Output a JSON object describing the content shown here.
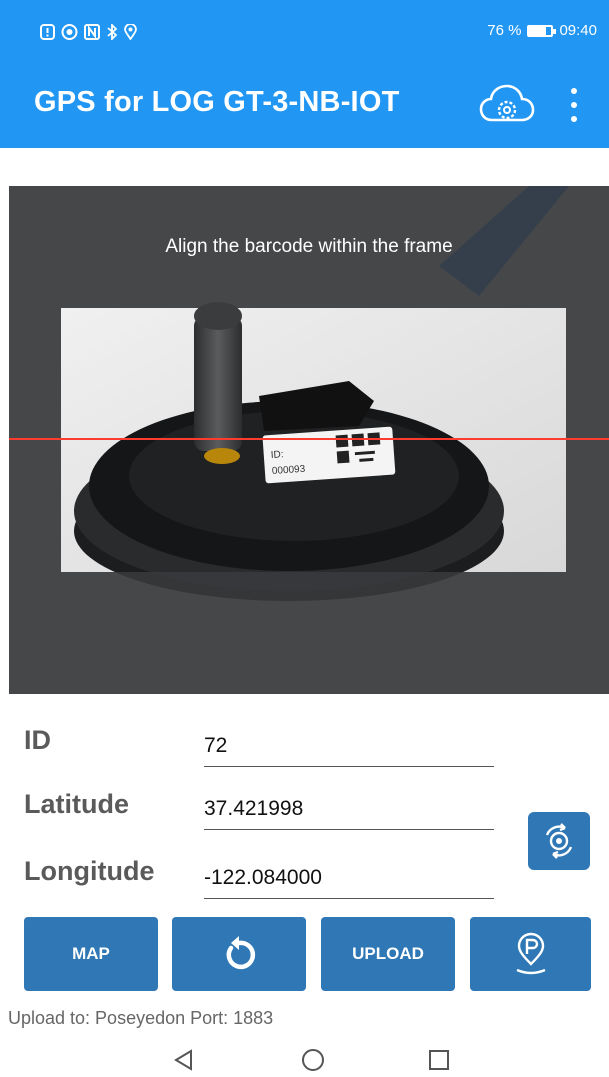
{
  "status_bar": {
    "left_icons": [
      "notification-icon",
      "eye-icon",
      "nfc-icon",
      "bluetooth-icon",
      "location-icon"
    ],
    "battery_percent": 76,
    "battery_text": "76 %",
    "time": "09:40"
  },
  "app_bar": {
    "title": "GPS for LOG GT-3-NB-IOT",
    "cloud_settings_icon": "cloud-gear-icon",
    "overflow_icon": "more-vert-icon"
  },
  "scanner": {
    "instruction": "Align the barcode within the frame",
    "label_id_text": "ID:",
    "label_code_text": "000093"
  },
  "form": {
    "id_label": "ID",
    "id_value": "72",
    "latitude_label": "Latitude",
    "latitude_value": "37.421998",
    "longitude_label": "Longitude",
    "longitude_value": "-122.084000"
  },
  "buttons": {
    "map_label": "MAP",
    "refresh_icon": "refresh-icon",
    "upload_label": "UPLOAD",
    "parking_icon": "parking-location-icon",
    "locate_icon": "gps-locate-icon"
  },
  "footer": {
    "upload_info": "Upload to: Poseyedon Port: 1883"
  },
  "colors": {
    "primary": "#2196f3",
    "button": "#2f78b5",
    "scanline": "#ff3b30"
  }
}
